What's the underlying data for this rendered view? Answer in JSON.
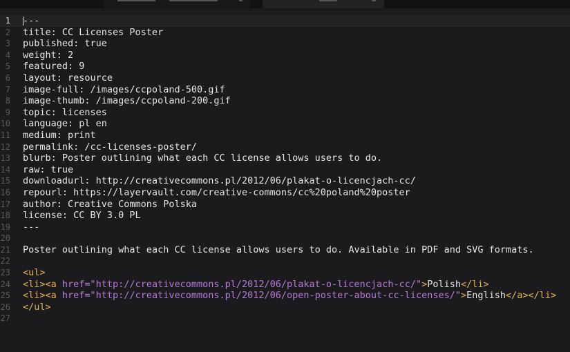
{
  "editor": {
    "current_line": 1,
    "lines": [
      "---",
      "title: CC Licenses Poster",
      "published: true",
      "weight: 2",
      "featured: 9",
      "layout: resource",
      "image-full: /images/ccpoland-500.gif",
      "image-thumb: /images/ccpoland-200.gif",
      "topic: licenses",
      "language: pl en",
      "medium: print",
      "permalink: /cc-licenses-poster/",
      "blurb: Poster outlining what each CC license allows users to do.",
      "raw: true",
      "downloadurl: http://creativecommons.pl/2012/06/plakat-o-licencjach-cc/",
      "repourl: https://layervault.com/creative-commons/cc%20poland%20poster",
      "author: Creative Commons Polska",
      "license: CC BY 3.0 PL",
      "---",
      "",
      "Poster outlining what each CC license allows users to do. Available in PDF and SVG formats.",
      "",
      "<ul>",
      "<li><a href=\"http://creativecommons.pl/2012/06/plakat-o-licencjach-cc/\">Polish</li>",
      "<li><a href=\"http://creativecommons.pl/2012/06/open-poster-about-cc-licenses/\">English</a></li>",
      "</ul>",
      ""
    ],
    "html_lines": {
      "l23": {
        "tag": "<ul>"
      },
      "l24": {
        "open1": "<li>",
        "open2": "<a ",
        "attr": "href=",
        "url": "\"http://creativecommons.pl/2012/06/plakat-o-licencjach-cc/\"",
        "close_bracket": ">",
        "text": "Polish",
        "close": "</li>"
      },
      "l25": {
        "open1": "<li>",
        "open2": "<a ",
        "attr": "href=",
        "url": "\"http://creativecommons.pl/2012/06/open-poster-about-cc-licenses/\"",
        "close_bracket": ">",
        "text": "English",
        "close_a": "</a>",
        "close": "</li>"
      },
      "l26": {
        "tag": "</ul>"
      }
    }
  }
}
